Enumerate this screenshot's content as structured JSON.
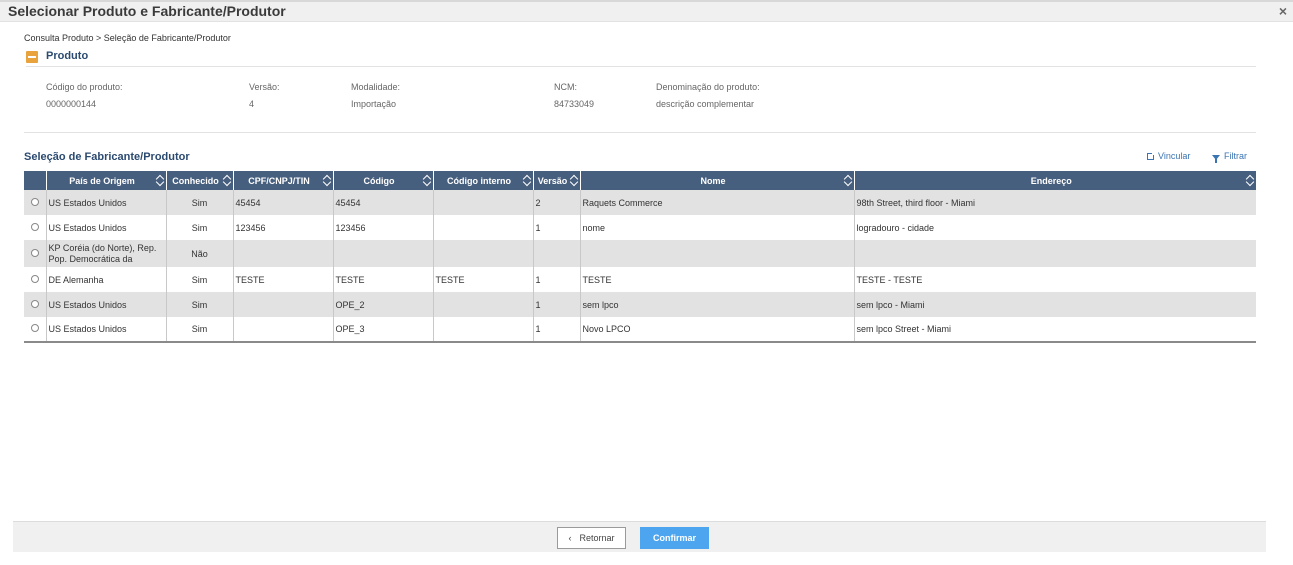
{
  "window": {
    "title": "Selecionar Produto e Fabricante/Produtor",
    "close_glyph": "×"
  },
  "breadcrumb": "Consulta Produto > Seleção de Fabricante/Produtor",
  "produto": {
    "section_title": "Produto",
    "fields": [
      {
        "label": "Código do produto:",
        "value": "0000000144"
      },
      {
        "label": "Versão:",
        "value": "4"
      },
      {
        "label": "Modalidade:",
        "value": "Importação"
      },
      {
        "label": "NCM:",
        "value": "84733049"
      },
      {
        "label": "Denominação do produto:",
        "value": "descrição complementar"
      }
    ]
  },
  "selecao": {
    "title": "Seleção de Fabricante/Produtor",
    "vincular_label": "Vincular",
    "filtrar_label": "Filtrar",
    "columns": [
      "País de Origem",
      "Conhecido",
      "CPF/CNPJ/TIN",
      "Código",
      "Código interno",
      "Versão",
      "Nome",
      "Endereço"
    ],
    "rows": [
      {
        "pais": "US Estados Unidos",
        "conhecido": "Sim",
        "cpf": "45454",
        "codigo": "45454",
        "interno": "",
        "versao": "2",
        "nome": "Raquets Commerce",
        "endereco": "98th Street, third floor - Miami"
      },
      {
        "pais": "US Estados Unidos",
        "conhecido": "Sim",
        "cpf": "123456",
        "codigo": "123456",
        "interno": "",
        "versao": "1",
        "nome": "nome",
        "endereco": "logradouro - cidade"
      },
      {
        "pais": "KP Coréia (do Norte), Rep. Pop. Democrática da",
        "conhecido": "Não",
        "cpf": "",
        "codigo": "",
        "interno": "",
        "versao": "",
        "nome": "",
        "endereco": ""
      },
      {
        "pais": "DE Alemanha",
        "conhecido": "Sim",
        "cpf": "TESTE",
        "codigo": "TESTE",
        "interno": "TESTE",
        "versao": "1",
        "nome": "TESTE",
        "endereco": "TESTE - TESTE"
      },
      {
        "pais": "US Estados Unidos",
        "conhecido": "Sim",
        "cpf": "",
        "codigo": "OPE_2",
        "interno": "",
        "versao": "1",
        "nome": "sem lpco",
        "endereco": "sem lpco - Miami"
      },
      {
        "pais": "US Estados Unidos",
        "conhecido": "Sim",
        "cpf": "",
        "codigo": "OPE_3",
        "interno": "",
        "versao": "1",
        "nome": "Novo LPCO",
        "endereco": "sem lpco Street - Miami"
      }
    ]
  },
  "footer": {
    "back_label": "Retornar",
    "back_glyph": "‹",
    "confirm_label": "Confirmar"
  },
  "colors": {
    "header_bg": "#475f7e",
    "accent_orange": "#e8a33d",
    "title_blue": "#2b4a70",
    "confirm_blue": "#4da5f0",
    "link_blue": "#3b74b3"
  }
}
